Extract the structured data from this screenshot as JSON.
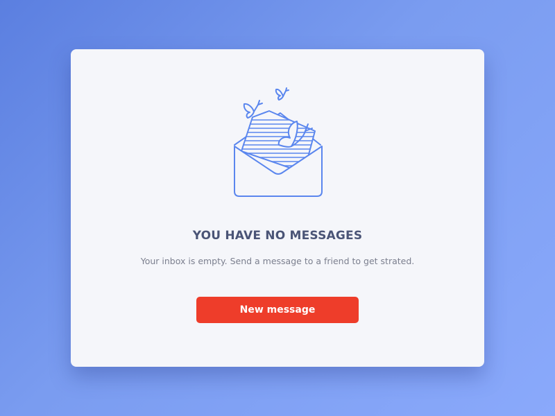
{
  "empty_state": {
    "illustration": "envelope-with-butterflies-icon",
    "title": "YOU HAVE NO MESSAGES",
    "subtitle": "Your inbox is empty. Send a message to a friend to get strated.",
    "button_label": "New message"
  },
  "colors": {
    "background_start": "#5b7fe0",
    "background_end": "#8aa9fb",
    "card": "#f5f6fa",
    "icon_stroke": "#5a86ee",
    "title": "#4a5476",
    "subtitle": "#7b7f8e",
    "button": "#ee3d2a",
    "button_text": "#ffffff"
  }
}
